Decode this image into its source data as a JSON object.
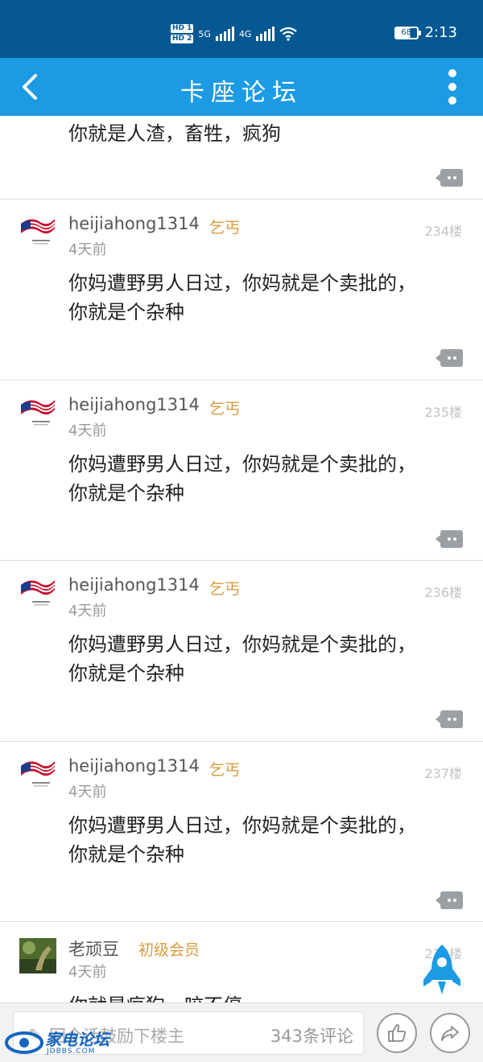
{
  "status_bar": {
    "hd1": "HD 1",
    "hd2": "HD 2",
    "net1": "5G",
    "net2": "4G",
    "battery": "68",
    "time": "2:13"
  },
  "header": {
    "title": "卡座论坛"
  },
  "top_post": {
    "content": "你就是人渣，畜牲，疯狗"
  },
  "posts": [
    {
      "user": "heijiahong1314",
      "badge": "乞丐",
      "time": "4天前",
      "floor": "234楼",
      "content": "你妈遭野男人日过，你妈就是个卖批的，你就是个杂种"
    },
    {
      "user": "heijiahong1314",
      "badge": "乞丐",
      "time": "4天前",
      "floor": "235楼",
      "content": "你妈遭野男人日过，你妈就是个卖批的，你就是个杂种"
    },
    {
      "user": "heijiahong1314",
      "badge": "乞丐",
      "time": "4天前",
      "floor": "236楼",
      "content": "你妈遭野男人日过，你妈就是个卖批的，你就是个杂种"
    },
    {
      "user": "heijiahong1314",
      "badge": "乞丐",
      "time": "4天前",
      "floor": "237楼",
      "content": "你妈遭野男人日过，你妈就是个卖批的，你就是个杂种"
    },
    {
      "user": "老顽豆",
      "badge": "初级会员",
      "time": "4天前",
      "floor": "238楼",
      "content": "你就是疯狗，咬不停"
    }
  ],
  "bottom_bar": {
    "reply_placeholder": "回个话鼓励下楼主",
    "comment_count": "343条评论"
  },
  "watermark": {
    "text": "家电论坛",
    "sub": "JDBBS.COM"
  },
  "colors": {
    "status_bg": "#065893",
    "nav_bg": "#1c9ae3",
    "badge": "#d79b3c"
  }
}
